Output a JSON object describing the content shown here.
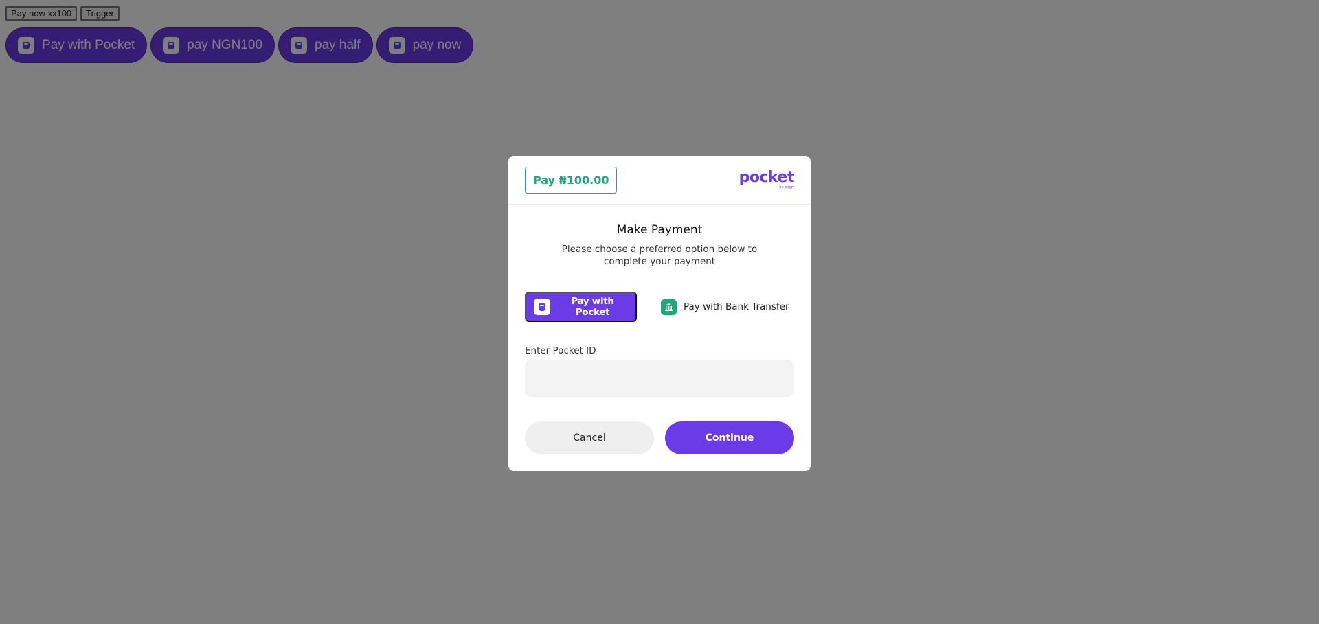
{
  "page": {
    "top_buttons": [
      "Pay now xx100",
      "Trigger"
    ],
    "pocket_buttons": [
      "Pay with Pocket",
      "pay NGN100",
      "pay half",
      "pay now"
    ]
  },
  "modal": {
    "amount": "Pay ₦100.00",
    "logo_text": "pocket",
    "logo_subtext": "by piggy",
    "title": "Make Payment",
    "subtitle": "Please choose a preferred option below to complete your payment",
    "options": {
      "pocket_label": "Pay with Pocket",
      "bank_label": "Pay with Bank Transfer",
      "selected": "pocket"
    },
    "field": {
      "label": "Enter Pocket ID",
      "value": "",
      "placeholder": ""
    },
    "actions": {
      "cancel": "Cancel",
      "continue": "Continue"
    }
  },
  "colors": {
    "brand_purple": "#6c3be8",
    "accent_green": "#1fa67a",
    "overlay": "rgba(0,0,0,0.5)"
  },
  "icons": {
    "pocket_wallet": "wallet-icon",
    "bank": "bank-icon"
  }
}
